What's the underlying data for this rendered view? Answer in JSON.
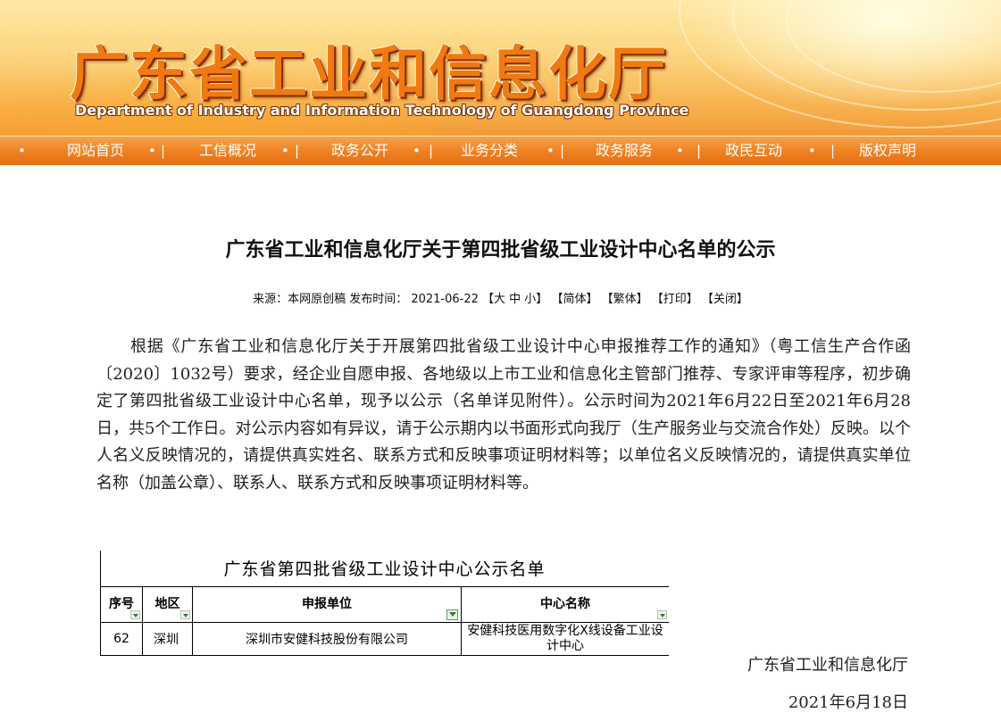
{
  "header": {
    "title": "广东省工业和信息化厅",
    "subtitle": "Department of Industry and Information Technology of Guangdong Province"
  },
  "nav": {
    "items": [
      "网站首页",
      "工信概况",
      "政务公开",
      "业务分类",
      "政务服务",
      "政民互动",
      "版权声明"
    ],
    "bullet": "•",
    "sep": "|"
  },
  "article": {
    "title": "广东省工业和信息化厅关于第四批省级工业设计中心名单的公示",
    "meta": {
      "source": "来源：本网原创稿 发布时间：  2021-06-22",
      "font_size": "【大 中 小】",
      "simplified": "【简体】",
      "traditional": "【繁体】",
      "print": "【打印】",
      "close": "【关闭】"
    },
    "body": "根据《广东省工业和信息化厅关于开展第四批省级工业设计中心申报推荐工作的通知》（粤工信生产合作函〔2020〕1032号）要求，经企业自愿申报、各地级以上市工业和信息化主管部门推荐、专家评审等程序，初步确定了第四批省级工业设计中心名单，现予以公示（名单详见附件）。公示时间为2021年6月22日至2021年6月28日，共5个工作日。对公示内容如有异议，请于公示期内以书面形式向我厅（生产服务业与交流合作处）反映。以个人名义反映情况的，请提供真实姓名、联系方式和反映事项证明材料等；以单位名义反映情况的，请提供真实单位名称（加盖公章）、联系人、联系方式和反映事项证明材料等。",
    "signature": "广东省工业和信息化厅",
    "date": "2021年6月18日"
  },
  "table": {
    "title": "广东省第四批省级工业设计中心公示名单",
    "headers": [
      "序号",
      "地区",
      "申报单位",
      "中心名称"
    ],
    "rows": [
      [
        "62",
        "深圳",
        "深圳市安健科技股份有限公司",
        "安健科技医用数字化X线设备工业设计中心"
      ]
    ]
  }
}
